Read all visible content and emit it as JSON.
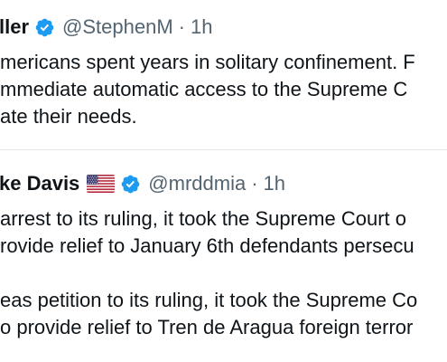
{
  "tweets": [
    {
      "name": "ller",
      "handle": "@StephenM",
      "separator": "·",
      "time": "1h",
      "lines": [
        "mericans spent years in solitary confinement. F",
        "mmediate automatic access to the Supreme C",
        "ate their needs."
      ]
    },
    {
      "name": "ke Davis",
      "handle": "@mrddmia",
      "separator": "·",
      "time": "1h",
      "lines": [
        "arrest to its ruling, it took the Supreme Court o",
        "rovide relief to January 6th defendants persecu",
        "",
        "eas petition to its ruling, it took the Supreme Co",
        "o provide relief to Tren de Aragua foreign terror"
      ]
    }
  ],
  "colors": {
    "text": "#0f1419",
    "secondary": "#536471",
    "verified": "#1d9bf0",
    "divider": "#e3e6e8"
  },
  "icons": [
    "verified-badge-icon",
    "us-flag-emoji-icon"
  ]
}
